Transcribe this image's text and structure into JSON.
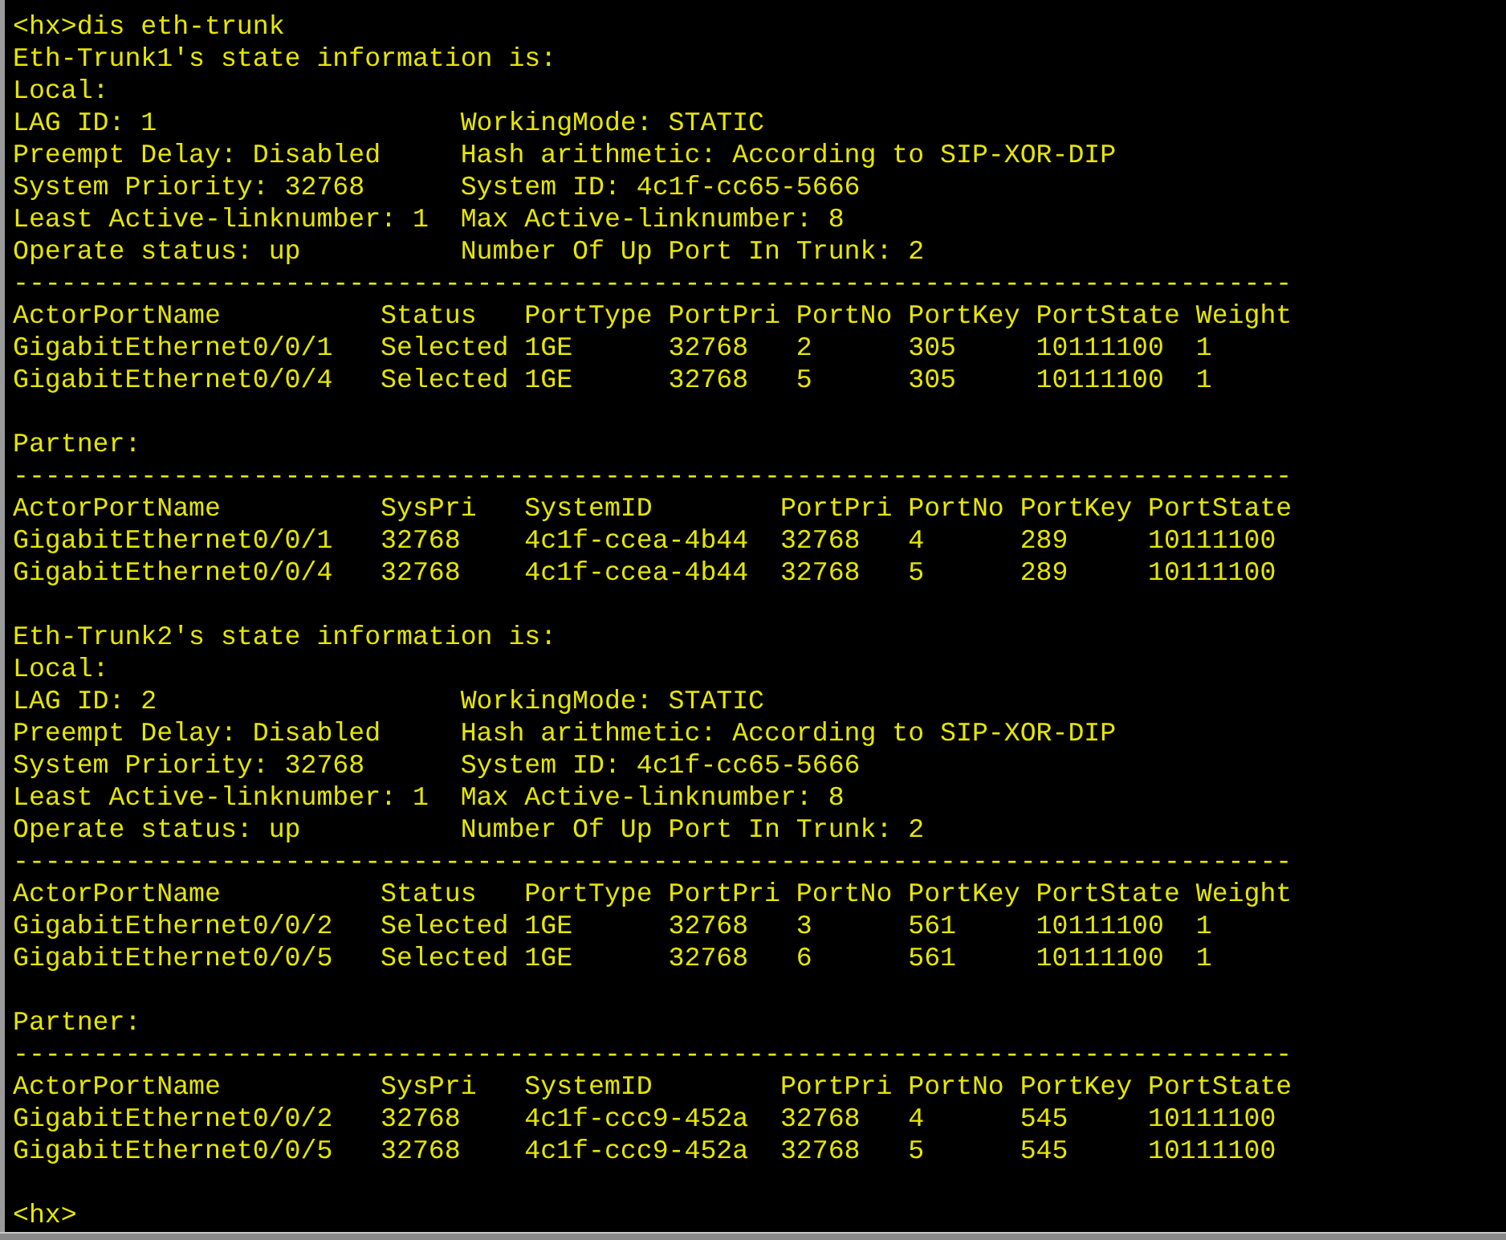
{
  "terminal": {
    "blocks": [
      {
        "lines": [
          "<hx>dis eth-trunk",
          "Eth-Trunk1's state information is:",
          "Local:",
          "LAG ID: 1                   WorkingMode: STATIC",
          "Preempt Delay: Disabled     Hash arithmetic: According to SIP-XOR-DIP",
          "System Priority: 32768      System ID: 4c1f-cc65-5666",
          "Least Active-linknumber: 1  Max Active-linknumber: 8",
          "Operate status: up          Number Of Up Port In Trunk: 2",
          "--------------------------------------------------------------------------------",
          "ActorPortName          Status   PortType PortPri PortNo PortKey PortState Weight",
          "GigabitEthernet0/0/1   Selected 1GE      32768   2      305     10111100  1",
          "GigabitEthernet0/0/4   Selected 1GE      32768   5      305     10111100  1"
        ]
      },
      {
        "lines": [
          "Partner:",
          "--------------------------------------------------------------------------------",
          "ActorPortName          SysPri   SystemID        PortPri PortNo PortKey PortState",
          "GigabitEthernet0/0/1   32768    4c1f-ccea-4b44  32768   4      289     10111100",
          "GigabitEthernet0/0/4   32768    4c1f-ccea-4b44  32768   5      289     10111100"
        ]
      },
      {
        "lines": [
          "Eth-Trunk2's state information is:",
          "Local:",
          "LAG ID: 2                   WorkingMode: STATIC",
          "Preempt Delay: Disabled     Hash arithmetic: According to SIP-XOR-DIP",
          "System Priority: 32768      System ID: 4c1f-cc65-5666",
          "Least Active-linknumber: 1  Max Active-linknumber: 8",
          "Operate status: up          Number Of Up Port In Trunk: 2",
          "--------------------------------------------------------------------------------",
          "ActorPortName          Status   PortType PortPri PortNo PortKey PortState Weight",
          "GigabitEthernet0/0/2   Selected 1GE      32768   3      561     10111100  1",
          "GigabitEthernet0/0/5   Selected 1GE      32768   6      561     10111100  1"
        ]
      },
      {
        "lines": [
          "Partner:",
          "--------------------------------------------------------------------------------",
          "ActorPortName          SysPri   SystemID        PortPri PortNo PortKey PortState",
          "GigabitEthernet0/0/2   32768    4c1f-ccc9-452a  32768   4      545     10111100",
          "GigabitEthernet0/0/5   32768    4c1f-ccc9-452a  32768   5      545     10111100"
        ]
      },
      {
        "lines": [
          "<hx>"
        ]
      }
    ]
  }
}
